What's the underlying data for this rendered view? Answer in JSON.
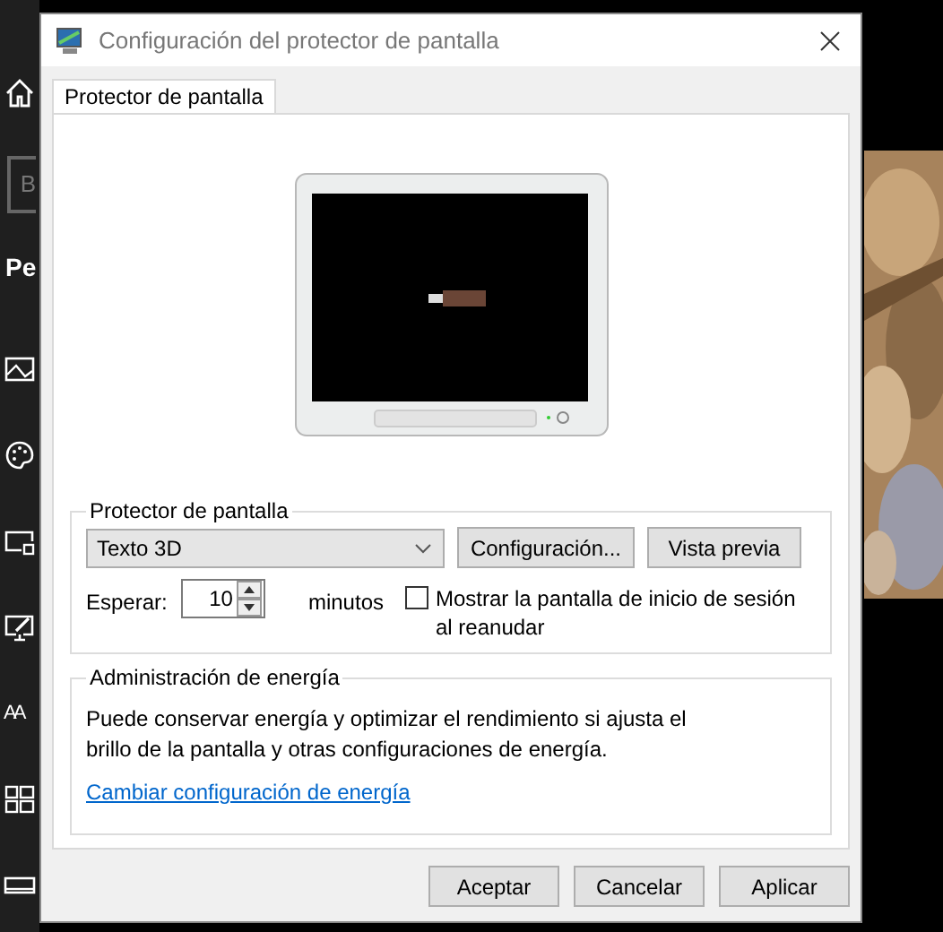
{
  "background_window": {
    "search_field_text": "B",
    "heading": "Pe",
    "font_icon_text": "AA"
  },
  "dialog": {
    "title": "Configuración del protector de pantalla",
    "tabs": [
      {
        "label": "Protector de pantalla",
        "selected": true
      }
    ],
    "screensaver_group": {
      "title": "Protector de pantalla",
      "dropdown": {
        "value": "Texto 3D"
      },
      "buttons": [
        "Configuración...",
        "Vista previa"
      ],
      "wait_label": "Esperar:",
      "wait_value": "10",
      "wait_unit": "minutos",
      "logon_checkbox": {
        "label": "Mostrar la pantalla de inicio de sesión al reanudar",
        "checked": false
      }
    },
    "power_group": {
      "title": "Administración de energía",
      "description": "Puede conservar energía y optimizar el rendimiento si ajusta el brillo de la pantalla y otras configuraciones de energía.",
      "link": "Cambiar configuración de energía"
    },
    "buttons": [
      "Aceptar",
      "Cancelar",
      "Aplicar"
    ]
  }
}
